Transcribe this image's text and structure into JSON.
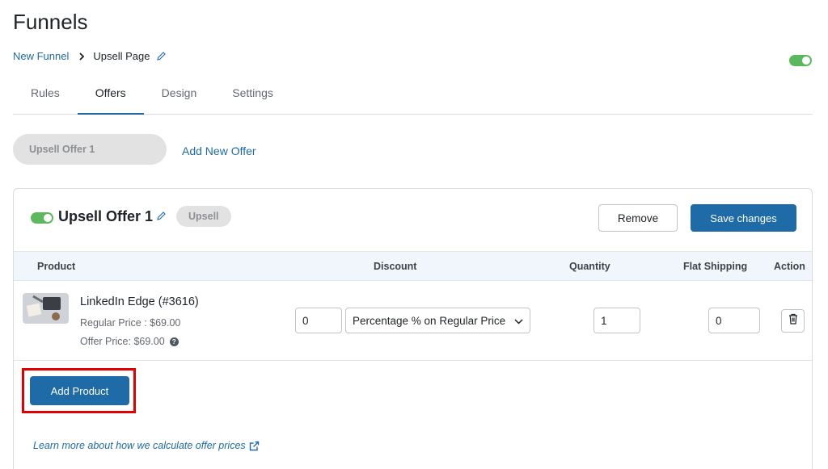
{
  "page": {
    "title": "Funnels"
  },
  "breadcrumb": {
    "parent": "New Funnel",
    "current": "Upsell Page"
  },
  "tabs": [
    {
      "label": "Rules"
    },
    {
      "label": "Offers"
    },
    {
      "label": "Design"
    },
    {
      "label": "Settings"
    }
  ],
  "offers_bar": {
    "offer_pill": "Upsell Offer 1",
    "add_new": "Add New Offer"
  },
  "offer": {
    "title": "Upsell Offer 1",
    "type_badge": "Upsell",
    "enabled": true,
    "remove_label": "Remove",
    "save_label": "Save changes"
  },
  "table": {
    "headers": {
      "product": "Product",
      "discount": "Discount",
      "quantity": "Quantity",
      "flat_shipping": "Flat Shipping",
      "action": "Action"
    },
    "rows": [
      {
        "name": "LinkedIn Edge (#3616)",
        "regular_price": "Regular Price : $69.00",
        "offer_price": "Offer Price: $69.00",
        "discount_value": "0",
        "discount_type": "Percentage % on Regular Price",
        "quantity": "1",
        "flat_shipping": "0"
      }
    ]
  },
  "add_product_label": "Add Product",
  "learn_more": "Learn more about how we calculate offer prices",
  "colors": {
    "accent": "#1e6ba8",
    "toggle_on": "#5cb85c",
    "highlight": "#e00000"
  }
}
